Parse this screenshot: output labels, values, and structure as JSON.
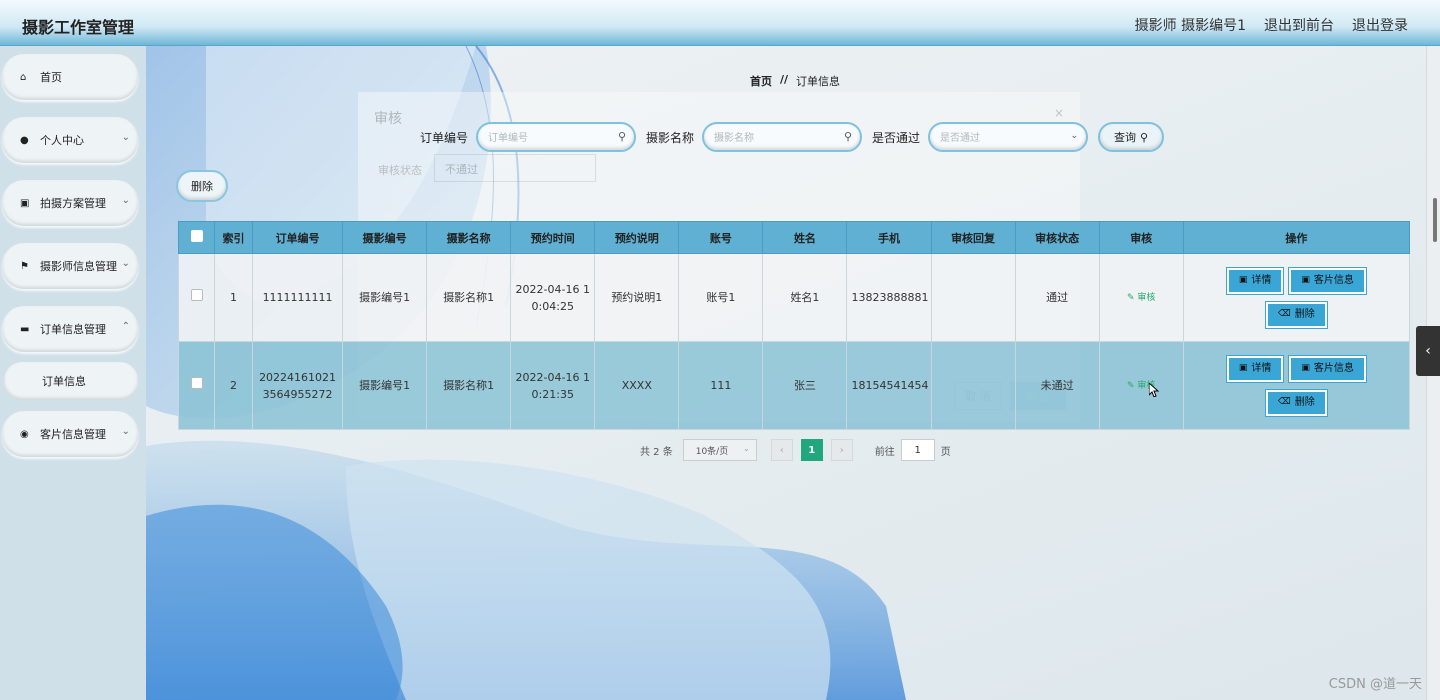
{
  "app": {
    "title": "摄影工作室管理"
  },
  "header": {
    "user": "摄影师 摄影编号1",
    "front": "退出到前台",
    "logout": "退出登录"
  },
  "sidebar": {
    "items": [
      {
        "label": "首页",
        "icon": "home-icon"
      },
      {
        "label": "个人中心",
        "icon": "user-icon"
      },
      {
        "label": "拍摄方案管理",
        "icon": "clipboard-icon"
      },
      {
        "label": "摄影师信息管理",
        "icon": "flag-icon"
      },
      {
        "label": "订单信息管理",
        "icon": "cart-icon"
      },
      {
        "label": "客片信息管理",
        "icon": "pin-icon"
      }
    ],
    "sub_item": "订单信息"
  },
  "breadcrumb": {
    "home": "首页",
    "sep": "//",
    "current": "订单信息"
  },
  "ghost_dialog": {
    "title": "审核",
    "label": "审核状态",
    "select": "不通过",
    "cancel": "取 消",
    "ok": "确 定"
  },
  "search": {
    "order_label": "订单编号",
    "order_placeholder": "订单编号",
    "name_label": "摄影名称",
    "name_placeholder": "摄影名称",
    "pass_label": "是否通过",
    "pass_placeholder": "是否通过",
    "query": "查询"
  },
  "toolbar": {
    "delete": "删除"
  },
  "table": {
    "headers": [
      "索引",
      "订单编号",
      "摄影编号",
      "摄影名称",
      "预约时间",
      "预约说明",
      "账号",
      "姓名",
      "手机",
      "审核回复",
      "审核状态",
      "审核",
      "操作"
    ],
    "rows": [
      {
        "index": "1",
        "order_no": "1111111111",
        "photo_no": "摄影编号1",
        "photo_name": "摄影名称1",
        "time": "2022-04-16 10:04:25",
        "note": "预约说明1",
        "account": "账号1",
        "name": "姓名1",
        "phone": "13823888881",
        "reply": "",
        "status": "通过",
        "audit": "审核"
      },
      {
        "index": "2",
        "order_no": "202241610213564955272",
        "photo_no": "摄影编号1",
        "photo_name": "摄影名称1",
        "time": "2022-04-16 10:21:35",
        "note": "XXXX",
        "account": "111",
        "name": "张三",
        "phone": "18154541454",
        "reply": "",
        "status": "未通过",
        "audit": "审核"
      }
    ],
    "actions": {
      "detail": "详情",
      "client": "客片信息",
      "delete": "删除"
    }
  },
  "pagination": {
    "total": "共 2 条",
    "page_size": "10条/页",
    "current": "1",
    "goto_label": "前往",
    "goto_value": "1",
    "page_unit": "页"
  },
  "watermark": "CSDN @道一天",
  "colors": {
    "header_blue": "#5fb0d2",
    "button_blue": "#3aa6d6",
    "page_green": "#21a77c",
    "audit_green": "#2aa66a"
  }
}
